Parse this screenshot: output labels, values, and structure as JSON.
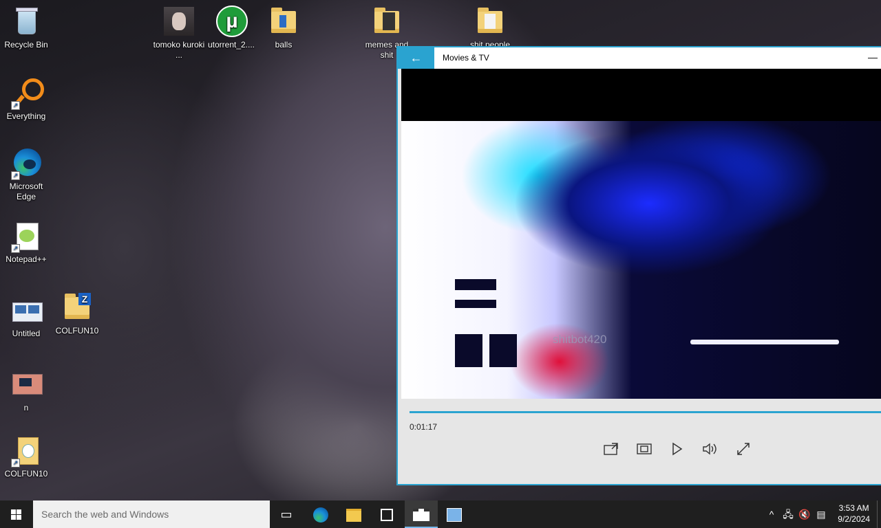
{
  "desktop": {
    "icons": [
      {
        "label": "Recycle Bin"
      },
      {
        "label": "Everything"
      },
      {
        "label": "Microsoft Edge"
      },
      {
        "label": "Notepad++"
      },
      {
        "label": "Untitled"
      },
      {
        "label": "COLFUN10"
      },
      {
        "label": "n"
      },
      {
        "label": "COLFUN10"
      },
      {
        "label": "tomoko kuroki ..."
      },
      {
        "label": "utorrent_2...."
      },
      {
        "label": "balls"
      },
      {
        "label": "memes and shit"
      },
      {
        "label": "shit people"
      }
    ]
  },
  "window": {
    "title": "Movies & TV",
    "back_icon": "arrow-left-icon",
    "minimize_label": "—"
  },
  "player": {
    "watermark": "shitbot420",
    "elapsed": "0:01:17",
    "progress_fraction": 1.0,
    "controls": [
      "cast-icon",
      "aspect-ratio-icon",
      "play-icon",
      "volume-icon",
      "fullscreen-icon"
    ]
  },
  "taskbar": {
    "search_placeholder": "Search the web and Windows",
    "time": "3:53 AM",
    "date": "9/2/2024",
    "accent": "#76b9ed"
  }
}
